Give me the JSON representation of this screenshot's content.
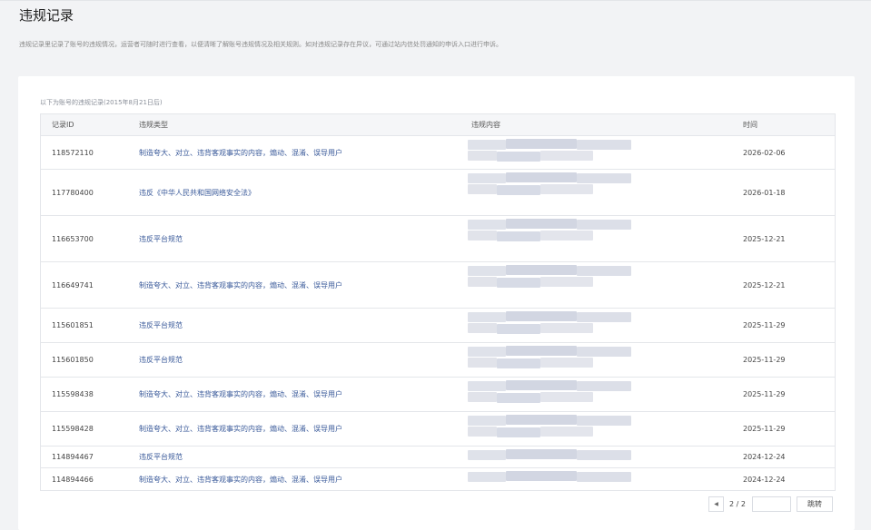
{
  "page": {
    "title": "违规记录",
    "intro": "违规记录里记录了账号的违规情况，运营者可随时进行查看，以便清晰了解账号违规情况及相关规则。如对违规记录存在异议，可通过站内信处罚通知的申诉入口进行申诉。"
  },
  "records": {
    "since_label": "以下为账号的违规记录(2015年8月21日后)",
    "columns": {
      "id": "记录ID",
      "type": "违规类型",
      "content": "违规内容",
      "time": "时间"
    },
    "rows": [
      {
        "id": "118572110",
        "type": "制造夸大、对立、违背客观事实的内容，煽动、混淆、误导用户",
        "time": "2026-02-06"
      },
      {
        "id": "117780400",
        "type": "违反《中华人民共和国网络安全法》",
        "time": "2026-01-18"
      },
      {
        "id": "116653700",
        "type": "违反平台规范",
        "time": "2025-12-21"
      },
      {
        "id": "116649741",
        "type": "制造夸大、对立、违背客观事实的内容，煽动、混淆、误导用户",
        "time": "2025-12-21"
      },
      {
        "id": "115601851",
        "type": "违反平台规范",
        "time": "2025-11-29"
      },
      {
        "id": "115601850",
        "type": "违反平台规范",
        "time": "2025-11-29"
      },
      {
        "id": "115598438",
        "type": "制造夸大、对立、违背客观事实的内容，煽动、混淆、误导用户",
        "time": "2025-11-29"
      },
      {
        "id": "115598428",
        "type": "制造夸大、对立、违背客观事实的内容，煽动、混淆、误导用户",
        "time": "2025-11-29"
      },
      {
        "id": "114894467",
        "type": "违反平台规范",
        "time": "2024-12-24"
      },
      {
        "id": "114894466",
        "type": "制造夸大、对立、违背客观事实的内容，煽动、混淆、误导用户",
        "time": "2024-12-24"
      }
    ]
  },
  "pagination": {
    "prev_icon": "chevron-left-icon",
    "page_text": "2 / 2",
    "input_value": "",
    "go_label": "跳转"
  },
  "colors": {
    "link": "#3a5a9a",
    "background": "#f2f3f5"
  }
}
